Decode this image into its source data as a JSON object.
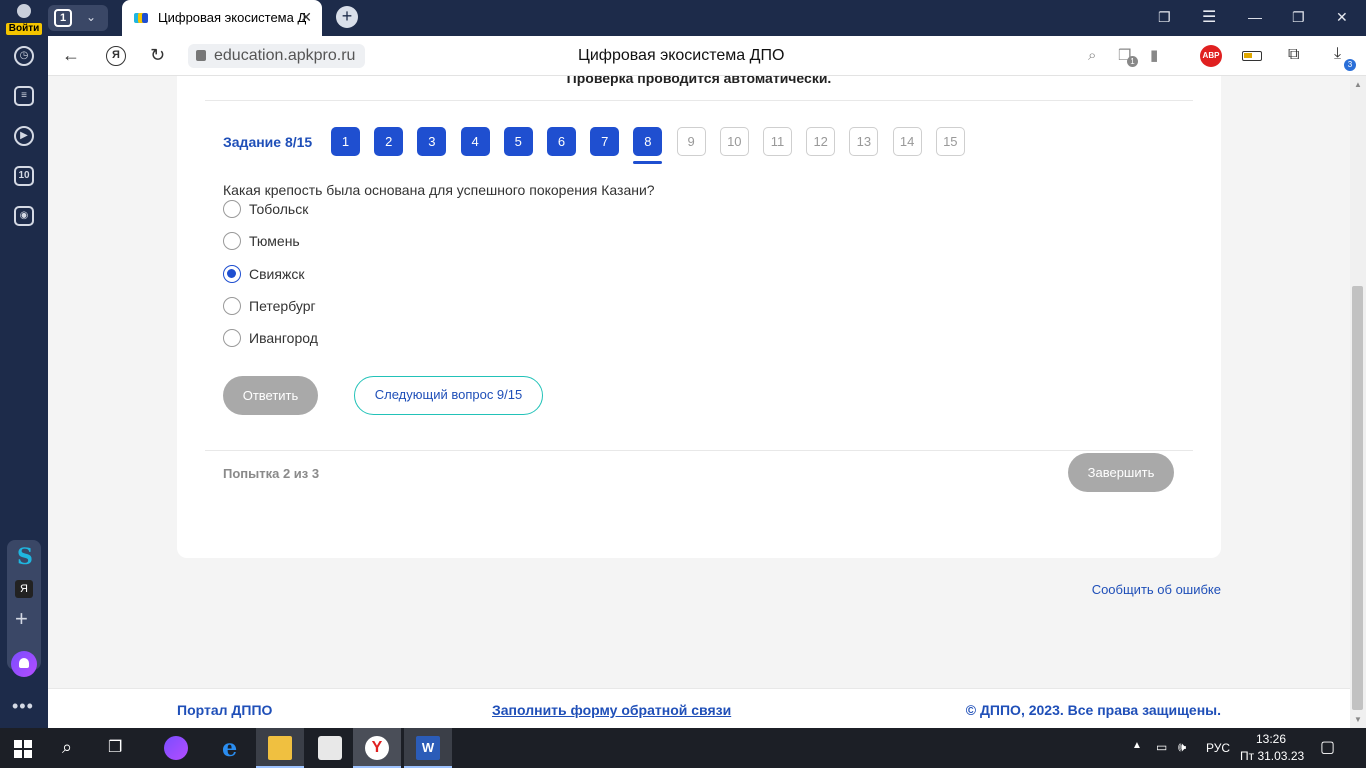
{
  "browser": {
    "profile_label": "Войти",
    "tab_count": "1",
    "active_tab_title": "Цифровая экосистема ДПО",
    "url": "education.apkpro.ru",
    "page_title": "Цифровая экосистема ДПО",
    "abp_label": "ABP",
    "downloads_count": "3",
    "tabs_badge": "1"
  },
  "sidebar": {
    "counter_label": "10",
    "ya_label": "Я"
  },
  "test": {
    "auto_check_notice": "Проверка проводится автоматически.",
    "task_label": "Задание 8/15",
    "questions": [
      {
        "label": "1",
        "state": "done"
      },
      {
        "label": "2",
        "state": "done"
      },
      {
        "label": "3",
        "state": "done"
      },
      {
        "label": "4",
        "state": "done"
      },
      {
        "label": "5",
        "state": "done"
      },
      {
        "label": "6",
        "state": "done"
      },
      {
        "label": "7",
        "state": "done"
      },
      {
        "label": "8",
        "state": "current"
      },
      {
        "label": "9",
        "state": "todo"
      },
      {
        "label": "10",
        "state": "todo"
      },
      {
        "label": "11",
        "state": "todo"
      },
      {
        "label": "12",
        "state": "todo"
      },
      {
        "label": "13",
        "state": "todo"
      },
      {
        "label": "14",
        "state": "todo"
      },
      {
        "label": "15",
        "state": "todo"
      }
    ],
    "question_text": "Какая крепость была основана для успешного покорения Казани?",
    "options": [
      {
        "label": "Тобольск",
        "selected": false
      },
      {
        "label": "Тюмень",
        "selected": false
      },
      {
        "label": "Свияжск",
        "selected": true
      },
      {
        "label": "Петербург",
        "selected": false
      },
      {
        "label": "Ивангород",
        "selected": false
      }
    ],
    "answer_button": "Ответить",
    "next_button": "Следующий вопрос 9/15",
    "attempt_text": "Попытка 2 из 3",
    "finish_button": "Завершить"
  },
  "report_link": "Сообщить об ошибке",
  "footer": {
    "portal_link": "Портал ДППО",
    "feedback_link": "Заполнить форму обратной связи",
    "copyright": "© ДППО, 2023. Все права защищены."
  },
  "taskbar": {
    "language": "РУС",
    "time": "13:26",
    "date": "Пт 31.03.23"
  },
  "colors": {
    "accent_blue": "#1f4fd0",
    "link_blue": "#1f4fb8",
    "teal_border": "#22c2b8",
    "disabled_gray": "#a9a9a9",
    "browser_chrome": "#1d2b4a"
  }
}
